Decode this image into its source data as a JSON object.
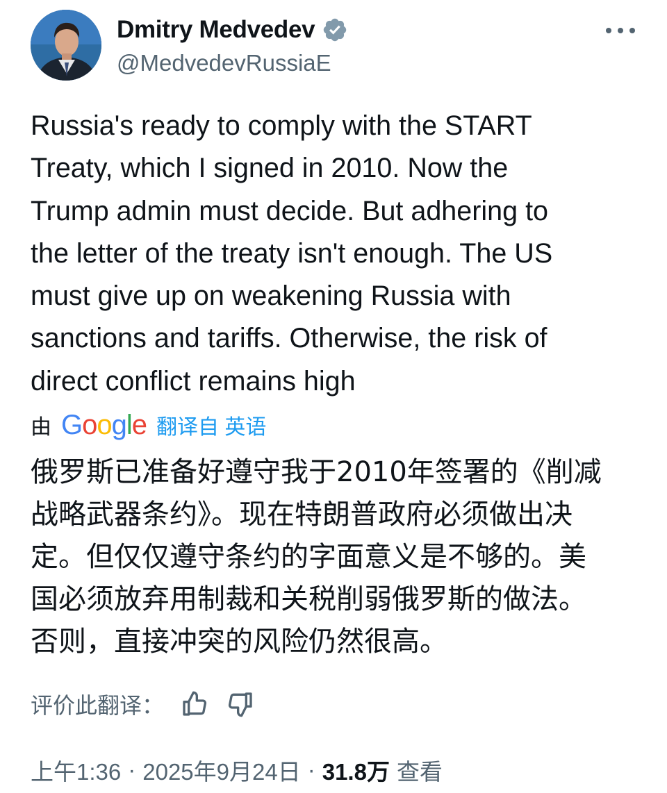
{
  "author": {
    "display_name": "Dmitry Medvedev",
    "handle": "@MedvedevRussiaE",
    "verified": true,
    "avatar_icon": "user-avatar-photo"
  },
  "tweet": {
    "text": "Russia's ready to comply with the START\nTreaty, which I signed in 2010. Now the\nTrump admin must decide. But adhering to\nthe letter of the treaty isn't enough. The US\nmust give up on weakening Russia with\nsanctions and tariffs. Otherwise, the risk of\ndirect conflict remains high"
  },
  "translation": {
    "by_label": "由",
    "provider": "Google",
    "from_label": "翻译自 英语",
    "text": "俄罗斯已准备好遵守我于2010年签署的《削减\n战略武器条约》。现在特朗普政府必须做出决\n定。但仅仅遵守条约的字面意义是不够的。美\n国必须放弃用制裁和关税削弱俄罗斯的做法。\n否则，直接冲突的风险仍然很高。",
    "rate_label": "评价此翻译："
  },
  "meta": {
    "time": "上午1:36",
    "separator": "·",
    "date": "2025年9月24日",
    "views_count": "31.8万",
    "views_label": "查看"
  },
  "colors": {
    "text": "#0f1419",
    "secondary": "#536471",
    "link": "#1d9bf0",
    "verified_badge": "#829aab"
  },
  "icons": {
    "verified": "verified-badge-icon",
    "more": "more-options-icon",
    "thumbs_up": "thumbs-up-icon",
    "thumbs_down": "thumbs-down-icon"
  }
}
